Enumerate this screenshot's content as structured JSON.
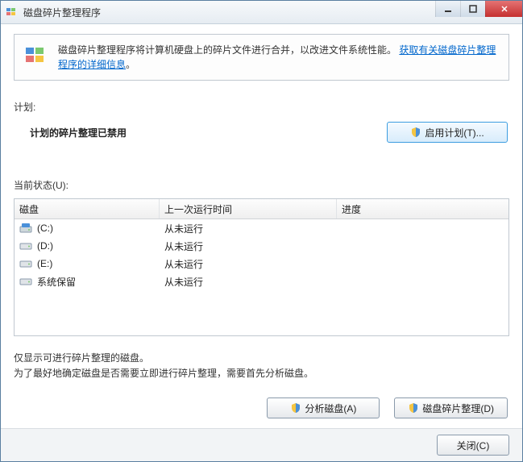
{
  "window": {
    "title": "磁盘碎片整理程序"
  },
  "info": {
    "text_before_link": "磁盘碎片整理程序将计算机硬盘上的碎片文件进行合并，以改进文件系统性能。",
    "link_text": "获取有关磁盘碎片整理程序的详细信息",
    "after_link": "。"
  },
  "schedule": {
    "label": "计划:",
    "status": "计划的碎片整理已禁用",
    "enable_button": "启用计划(T)..."
  },
  "current_status_label": "当前状态(U):",
  "table": {
    "headers": {
      "disk": "磁盘",
      "last_run": "上一次运行时间",
      "progress": "进度"
    },
    "rows": [
      {
        "icon": "c",
        "name": "(C:)",
        "last_run": "从未运行",
        "progress": ""
      },
      {
        "icon": "hd",
        "name": "(D:)",
        "last_run": "从未运行",
        "progress": ""
      },
      {
        "icon": "hd",
        "name": "(E:)",
        "last_run": "从未运行",
        "progress": ""
      },
      {
        "icon": "hd",
        "name": "系统保留",
        "last_run": "从未运行",
        "progress": ""
      }
    ]
  },
  "notes": {
    "line1": "仅显示可进行碎片整理的磁盘。",
    "line2": "为了最好地确定磁盘是否需要立即进行碎片整理，需要首先分析磁盘。"
  },
  "buttons": {
    "analyze": "分析磁盘(A)",
    "defrag": "磁盘碎片整理(D)",
    "close": "关闭(C)"
  }
}
